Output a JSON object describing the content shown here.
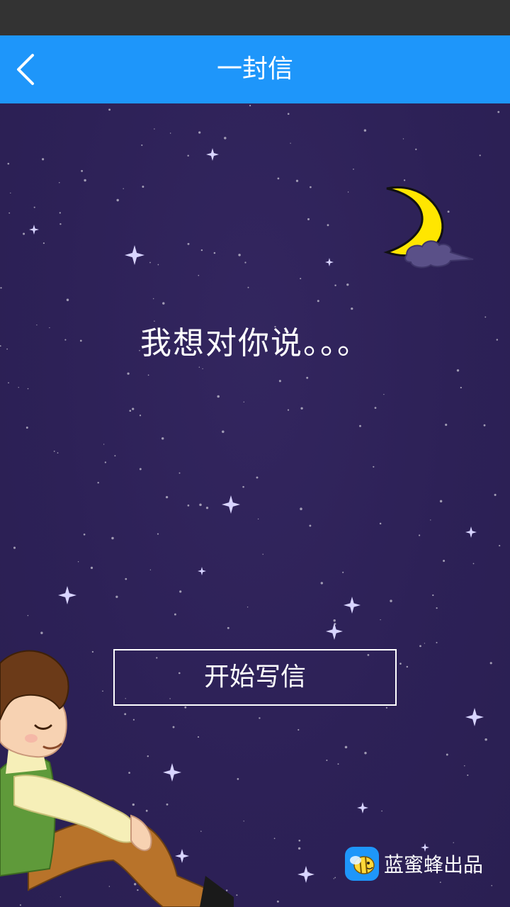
{
  "nav": {
    "title": "一封信",
    "back_icon": "chevron-left-icon"
  },
  "main": {
    "headline": "我想对你说。。。",
    "start_button_label": "开始写信"
  },
  "brand": {
    "icon": "bee-logo-icon",
    "label": "蓝蜜蜂出品"
  },
  "colors": {
    "status_bar": "#333333",
    "nav_bar": "#1e96fa",
    "background": "#2d2157",
    "moon": "#ffe600"
  }
}
